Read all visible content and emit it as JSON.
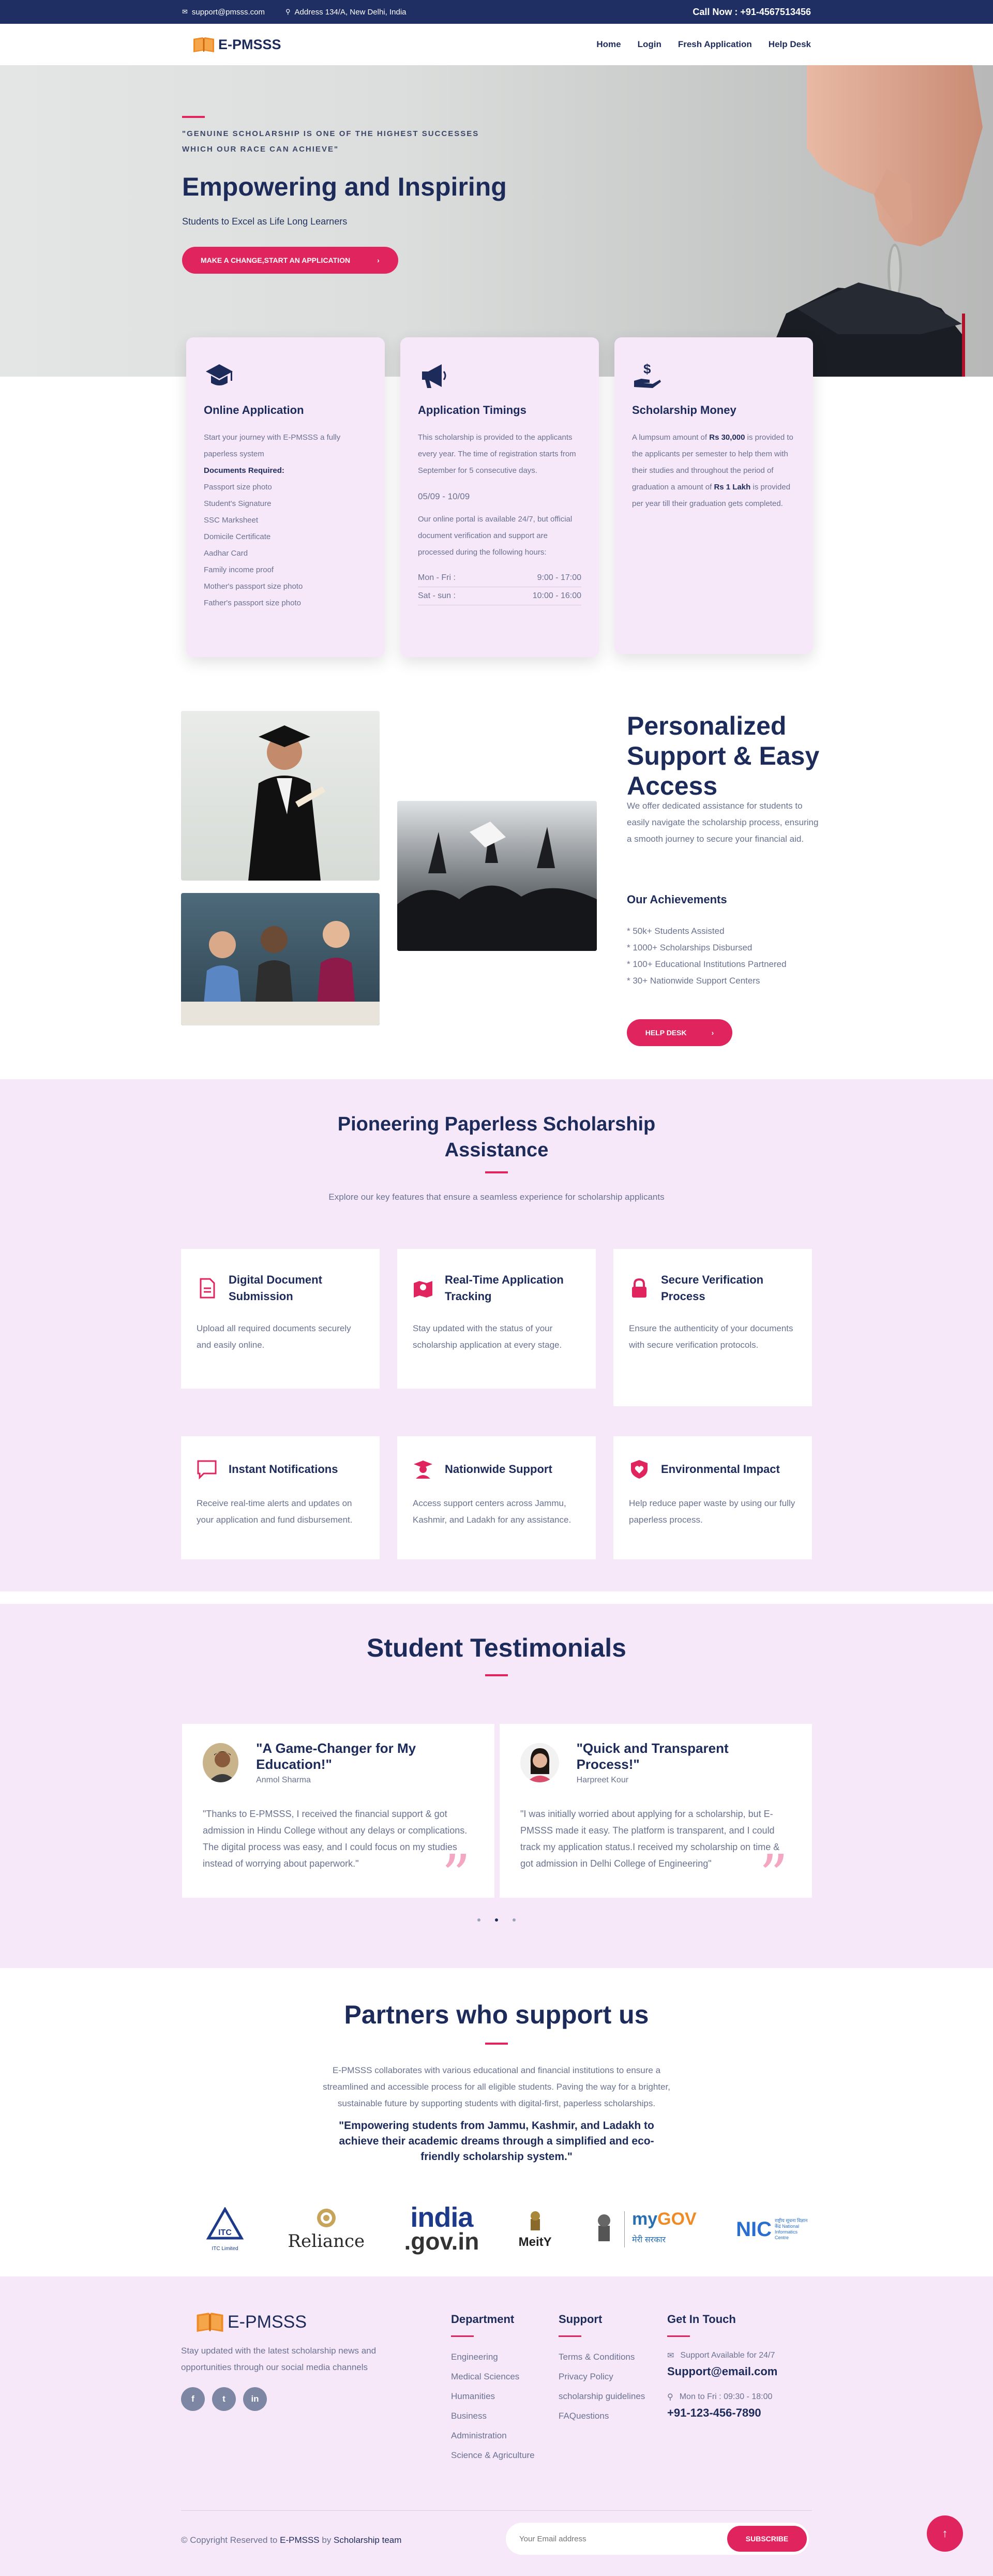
{
  "topbar": {
    "email": "support@pmsss.com",
    "address": "Address 134/A, New Delhi, India",
    "call": "Call Now : +91-4567513456"
  },
  "nav": {
    "brand": "E-PMSSS",
    "items": [
      "Home",
      "Login",
      "Fresh Application",
      "Help Desk"
    ]
  },
  "hero": {
    "quote": "\"GENUINE SCHOLARSHIP IS ONE OF THE HIGHEST SUCCESSES WHICH OUR RACE CAN ACHIEVE\"",
    "title": "Empowering and Inspiring",
    "subtitle": "Students to Excel as Life Long Learners",
    "cta": "MAKE A CHANGE,START AN APPLICATION",
    "cta_arrow": "›"
  },
  "cards": {
    "online": {
      "title": "Online Application",
      "intro": "Start your journey with E-PMSSS a fully paperless system",
      "docs_heading": "Documents Required:",
      "docs": [
        "Passport size photo",
        "Student's Signature",
        "SSC Marksheet",
        "Domicile Certificate",
        "Aadhar Card",
        "Family income proof",
        "Mother's passport size photo",
        "Father's passport size photo"
      ]
    },
    "timings": {
      "title": "Application Timings",
      "intro": "This scholarship is provided to the applicants every year. The time of registration starts from September for 5 consecutive days.",
      "dates": "05/09 - 10/09",
      "portal": "Our online portal is available 24/7, but official document verification and support are processed during the following hours:",
      "rows": [
        {
          "day": "Mon - Fri :",
          "time": "9:00 - 17:00"
        },
        {
          "day": "Sat - sun :",
          "time": "10:00 - 16:00"
        }
      ]
    },
    "money": {
      "title": "Scholarship Money",
      "t1": "A lumpsum amount of ",
      "b1": "Rs 30,000",
      "t2": " is provided to the applicants per semester to help them with their studies and throughout the period of graduation a amount of ",
      "b2": "Rs 1 Lakh",
      "t3": " is provided per year till their graduation gets completed."
    }
  },
  "support": {
    "title": "Personalized Support & Easy Access",
    "desc": "We offer dedicated assistance for students to easily navigate the scholarship process, ensuring a smooth journey to secure your financial aid.",
    "achievements_title": "Our Achievements",
    "achievements": [
      "* 50k+ Students Assisted",
      "* 1000+ Scholarships Disbursed",
      "* 100+ Educational Institutions Partnered",
      "* 30+ Nationwide Support Centers"
    ],
    "button": "HELP DESK",
    "button_arrow": "›"
  },
  "features": {
    "title": "Pioneering Paperless Scholarship Assistance",
    "intro": "Explore our key features that ensure a seamless experience for scholarship applicants",
    "items": [
      {
        "title": "Digital Document Submission",
        "text": "Upload all required documents securely and easily online.",
        "icon": "document-icon"
      },
      {
        "title": "Real-Time Application Tracking",
        "text": "Stay updated with the status of your scholarship application at every stage.",
        "icon": "map-pin-icon"
      },
      {
        "title": "Secure Verification Process",
        "text": "Ensure the authenticity of your documents with secure verification protocols.",
        "icon": "lock-icon"
      },
      {
        "title": "Instant Notifications",
        "text": "Receive real-time alerts and updates on your application and fund disbursement.",
        "icon": "chat-icon"
      },
      {
        "title": "Nationwide Support",
        "text": "Access support centers across Jammu, Kashmir, and Ladakh for any assistance.",
        "icon": "graduate-icon"
      },
      {
        "title": "Environmental Impact",
        "text": "Help reduce paper waste by using our fully paperless process.",
        "icon": "shield-heart-icon"
      }
    ]
  },
  "testimonials": {
    "title": "Student Testimonials",
    "items": [
      {
        "heading": "\"A Game-Changer for My Education!\"",
        "name": "Anmol Sharma",
        "text": "\"Thanks to E-PMSSS, I received the financial support & got admission in Hindu College without any delays or complications. The digital process was easy, and I could focus on my studies instead of worrying about paperwork.\""
      },
      {
        "heading": "\"Quick and Transparent Process!\"",
        "name": "Harpreet Kour",
        "text": "\"I was initially worried about applying for a scholarship, but E-PMSSS made it easy. The platform is transparent, and I could track my application status.I received my scholarship on time & got admission in Delhi College of Engineering\""
      }
    ],
    "quote_mark": "”"
  },
  "partners": {
    "title": "Partners who support us",
    "desc": "E-PMSSS collaborates with various educational and financial institutions to ensure a streamlined and accessible process for all eligible students. Paving the way for a brighter, sustainable future by supporting students with digital-first, paperless scholarships.",
    "quote": "\"Empowering students from Jammu, Kashmir, and Ladakh to achieve their academic dreams through a simplified and eco-friendly scholarship system.\"",
    "logos": {
      "itc": "ITC Limited",
      "reliance": "Reliance",
      "india": "india",
      "govin": ".gov.in",
      "meity": "MeitY",
      "mygov_my": "my",
      "mygov_gov": "GOV",
      "mygov_hindi": "मेरी सरकार",
      "nic": "NIC",
      "nic_sub": "राष्ट्रीय सूचना विज्ञान केंद्र National Informatics Centre"
    }
  },
  "footer": {
    "brand": "E-PMSSS",
    "about": "Stay updated with the latest scholarship news and opportunities through our social media channels",
    "social": [
      "f",
      "t",
      "in"
    ],
    "department": {
      "title": "Department",
      "items": [
        "Engineering",
        "Medical Sciences",
        "Humanities",
        "Business",
        "Administration",
        "Science & Agriculture"
      ]
    },
    "support": {
      "title": "Support",
      "items": [
        "Terms & Conditions",
        "Privacy Policy",
        "scholarship guidelines",
        "FAQuestions"
      ]
    },
    "contact": {
      "title": "Get In Touch",
      "support_label": "Support Available for 24/7",
      "email": "Support@email.com",
      "hours": "Mon to Fri : 09:30 - 18:00",
      "phone": "+91-123-456-7890"
    },
    "copy_prefix": "© Copyright Reserved to ",
    "copy_brand": "E-PMSSS",
    "copy_mid": " by ",
    "copy_team": "Scholarship team",
    "newsletter_placeholder": "Your Email address",
    "subscribe": "SUBSCRIBE",
    "totop": "↑"
  },
  "colors": {
    "primary": "#1d2b5a",
    "accent": "#e0245e",
    "panel": "#f6e8f9",
    "topbar": "#1f2f64"
  }
}
